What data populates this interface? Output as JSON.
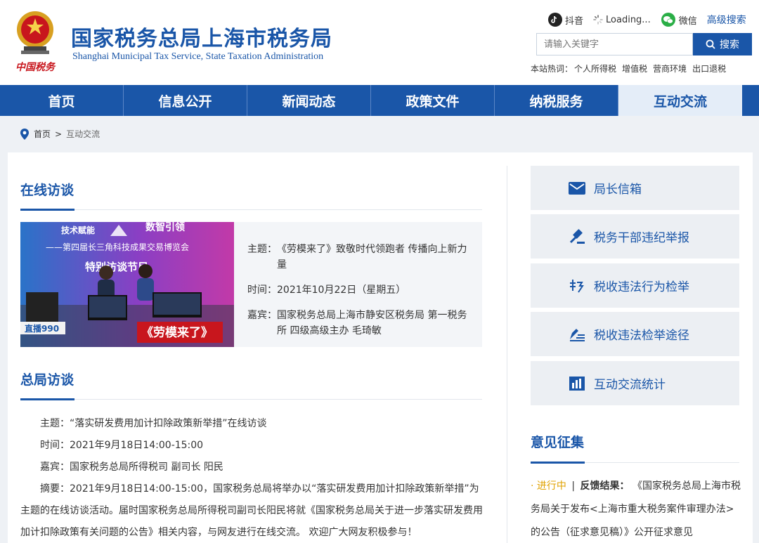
{
  "header": {
    "title": "国家税务总局上海市税务局",
    "subtitle": "Shanghai Municipal Tax Service, State Taxation Administration",
    "emblem_text": "中国税务",
    "links": {
      "douyin": "抖音",
      "loading": "Loading...",
      "wechat": "微信",
      "advanced_search": "高级搜索"
    },
    "search": {
      "placeholder": "请输入关键字",
      "button": "搜索"
    },
    "hot": {
      "label": "本站热词：",
      "terms": [
        "个人所得税",
        "增值税",
        "营商环境",
        "出口退税"
      ]
    }
  },
  "nav": [
    "首页",
    "信息公开",
    "新闻动态",
    "政策文件",
    "纳税服务",
    "互动交流"
  ],
  "breadcrumb": {
    "home": "首页",
    "sep": ">",
    "current": "互动交流"
  },
  "online_interview": {
    "title": "在线访谈",
    "image": {
      "banner_1": "技术赋能",
      "banner_2": "数智引领",
      "event": "——第四届长三角科技成果交易博览会",
      "column": "特别访谈节目",
      "station": "直播990",
      "program": "《劳模来了》"
    },
    "topic_label": "主题：",
    "topic": "《劳模来了》致敬时代领跑者 传播向上新力量",
    "time_label": "时间：",
    "time": "2021年10月22日（星期五）",
    "guest_label": "嘉宾：",
    "guest": "国家税务总局上海市静安区税务局 第一税务所 四级高级主办 毛琦敏"
  },
  "hq_interview": {
    "title": "总局访谈",
    "topic": "主题：“落实研发费用加计扣除政策新举措”在线访谈",
    "time": "时间：2021年9月18日14:00-15:00",
    "guest": "嘉宾：国家税务总局所得税司 副司长 阳民",
    "summary_1": "摘要：2021年9月18日14:00-15:00，国家税务总局将举办以“落实研发费用加计扣除政策新举措”为",
    "summary_2": "主题的在线访谈活动。届时国家税务总局所得税司副司长阳民将就《国家税务总局关于进一步落实研发费用",
    "summary_3": "加计扣除政策有关问题的公告》相关内容，与网友进行在线交流。 欢迎广大网友积极参与！"
  },
  "side": {
    "buttons": [
      "局长信箱",
      "税务干部违纪举报",
      "税收违法行为检举",
      "税收违法检举途径",
      "互动交流统计"
    ]
  },
  "opinion": {
    "title": "意见征集",
    "status": "进行中",
    "sep": "|",
    "result_label": "反馈结果：",
    "line_1": "《国家税务总局上海市税",
    "line_2": "务局关于发布<上海市重大税务案件审理办法>",
    "line_3": "的公告（征求意见稿）》公开征求意见"
  },
  "colors": {
    "brand": "#1a56a8",
    "nav_active_bg": "#e4edf8",
    "accent_gold": "#e0a200",
    "page_bg": "#eef1f5"
  }
}
